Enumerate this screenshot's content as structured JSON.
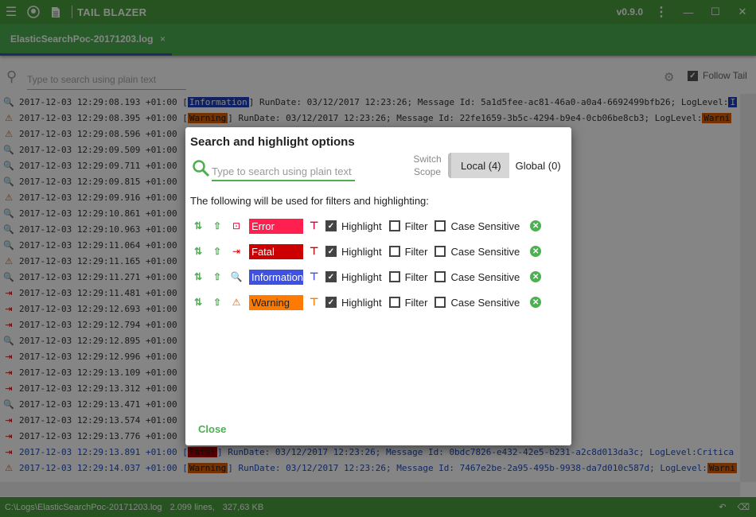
{
  "titlebar": {
    "title": "TAIL BLAZER",
    "version": "v0.9.0"
  },
  "tab": {
    "label": "ElasticSearchPoc-20171203.log",
    "close": "×"
  },
  "search": {
    "placeholder": "Type to search using plain text"
  },
  "follow_tail": {
    "label": "Follow Tail",
    "checked": true
  },
  "log_lines": [
    {
      "icon": "🔍",
      "ic": "#1f4fc0",
      "pre": "2017-12-03 12:29:08.193 +01:00 [",
      "level": "Information",
      "lvbg": "#1e3fbf",
      "lvfg": "#fff",
      "post": "] RunDate: 03/12/2017 12:23:26; Message Id: 5a1d5fee-ac81-46a0-a0a4-6692499bfb26; LogLevel: ",
      "end": "I",
      "endbg": "#1e3fbf",
      "endfg": "#fff",
      "blue": false
    },
    {
      "icon": "⚠",
      "ic": "#e06000",
      "pre": "2017-12-03 12:29:08.395 +01:00 [",
      "level": "Warning",
      "lvbg": "#e06000",
      "lvfg": "#222",
      "post": "] RunDate: 03/12/2017 12:23:26; Message Id: 22fe1659-3b5c-4294-b9e4-0cb06be8cb3; LogLevel: ",
      "end": "Warni",
      "endbg": "#e06000",
      "endfg": "#222",
      "blue": false
    },
    {
      "icon": "⚠",
      "ic": "#e06000",
      "pre": "2017-12-03 12:29:08.596 +01:00",
      "level": "",
      "lvbg": "",
      "lvfg": "",
      "post": "",
      "end": "",
      "endbg": "",
      "endfg": "",
      "blue": false
    },
    {
      "icon": "🔍",
      "ic": "#1f4fc0",
      "pre": "2017-12-03 12:29:09.509 +01:00",
      "level": "",
      "lvbg": "",
      "lvfg": "",
      "post": "",
      "end": "",
      "endbg": "",
      "endfg": "",
      "blue": false
    },
    {
      "icon": "🔍",
      "ic": "#1f4fc0",
      "pre": "2017-12-03 12:29:09.711 +01:00",
      "level": "",
      "lvbg": "",
      "lvfg": "",
      "post": "",
      "end": "",
      "endbg": "",
      "endfg": "",
      "blue": false
    },
    {
      "icon": "🔍",
      "ic": "#1f4fc0",
      "pre": "2017-12-03 12:29:09.815 +01:00",
      "level": "",
      "lvbg": "",
      "lvfg": "",
      "post": "",
      "end": "",
      "endbg": "",
      "endfg": "",
      "blue": false
    },
    {
      "icon": "⚠",
      "ic": "#e06000",
      "pre": "2017-12-03 12:29:09.916 +01:00",
      "level": "",
      "lvbg": "",
      "lvfg": "",
      "post": "",
      "end": "",
      "endbg": "",
      "endfg": "",
      "blue": false
    },
    {
      "icon": "🔍",
      "ic": "#1f4fc0",
      "pre": "2017-12-03 12:29:10.861 +01:00",
      "level": "",
      "lvbg": "",
      "lvfg": "",
      "post": "",
      "end": "",
      "endbg": "",
      "endfg": "",
      "blue": false
    },
    {
      "icon": "🔍",
      "ic": "#1f4fc0",
      "pre": "2017-12-03 12:29:10.963 +01:00",
      "level": "",
      "lvbg": "",
      "lvfg": "",
      "post": "",
      "end": "",
      "endbg": "",
      "endfg": "",
      "blue": false
    },
    {
      "icon": "🔍",
      "ic": "#1f4fc0",
      "pre": "2017-12-03 12:29:11.064 +01:00",
      "level": "",
      "lvbg": "",
      "lvfg": "",
      "post": "",
      "end": "",
      "endbg": "",
      "endfg": "",
      "blue": false
    },
    {
      "icon": "⚠",
      "ic": "#e06000",
      "pre": "2017-12-03 12:29:11.165 +01:00",
      "level": "",
      "lvbg": "",
      "lvfg": "",
      "post": "",
      "end": "",
      "endbg": "",
      "endfg": "",
      "blue": false
    },
    {
      "icon": "🔍",
      "ic": "#1f4fc0",
      "pre": "2017-12-03 12:29:11.271 +01:00",
      "level": "",
      "lvbg": "",
      "lvfg": "",
      "post": "",
      "end": "",
      "endbg": "",
      "endfg": "",
      "blue": false
    },
    {
      "icon": "⇥",
      "ic": "#c00",
      "pre": "2017-12-03 12:29:11.481 +01:00",
      "level": "",
      "lvbg": "",
      "lvfg": "",
      "post": "",
      "end": "",
      "endbg": "",
      "endfg": "",
      "blue": false
    },
    {
      "icon": "⇥",
      "ic": "#c00",
      "pre": "2017-12-03 12:29:12.693 +01:00",
      "level": "",
      "lvbg": "",
      "lvfg": "",
      "post": "",
      "end": "",
      "endbg": "",
      "endfg": "",
      "blue": false
    },
    {
      "icon": "⇥",
      "ic": "#c00",
      "pre": "2017-12-03 12:29:12.794 +01:00",
      "level": "",
      "lvbg": "",
      "lvfg": "",
      "post": "",
      "end": "",
      "endbg": "",
      "endfg": "",
      "blue": false
    },
    {
      "icon": "🔍",
      "ic": "#1f4fc0",
      "pre": "2017-12-03 12:29:12.895 +01:00",
      "level": "",
      "lvbg": "",
      "lvfg": "",
      "post": "",
      "end": "",
      "endbg": "",
      "endfg": "",
      "blue": false
    },
    {
      "icon": "⇥",
      "ic": "#c00",
      "pre": "2017-12-03 12:29:12.996 +01:00",
      "level": "",
      "lvbg": "",
      "lvfg": "",
      "post": "",
      "end": "",
      "endbg": "",
      "endfg": "",
      "blue": false
    },
    {
      "icon": "⇥",
      "ic": "#c00",
      "pre": "2017-12-03 12:29:13.109 +01:00",
      "level": "",
      "lvbg": "",
      "lvfg": "",
      "post": "",
      "end": "",
      "endbg": "",
      "endfg": "",
      "blue": false
    },
    {
      "icon": "⇥",
      "ic": "#c00",
      "pre": "2017-12-03 12:29:13.312 +01:00",
      "level": "",
      "lvbg": "",
      "lvfg": "",
      "post": "",
      "end": "",
      "endbg": "",
      "endfg": "",
      "blue": false
    },
    {
      "icon": "🔍",
      "ic": "#1f4fc0",
      "pre": "2017-12-03 12:29:13.471 +01:00",
      "level": "",
      "lvbg": "",
      "lvfg": "",
      "post": "",
      "end": "",
      "endbg": "",
      "endfg": "",
      "blue": false
    },
    {
      "icon": "⇥",
      "ic": "#c00",
      "pre": "2017-12-03 12:29:13.574 +01:00",
      "level": "",
      "lvbg": "",
      "lvfg": "",
      "post": "",
      "end": "",
      "endbg": "",
      "endfg": "",
      "blue": false
    },
    {
      "icon": "⇥",
      "ic": "#c00",
      "pre": "2017-12-03 12:29:13.776 +01:00",
      "level": "",
      "lvbg": "",
      "lvfg": "",
      "post": "",
      "end": "",
      "endbg": "",
      "endfg": "",
      "blue": false
    },
    {
      "icon": "⇥",
      "ic": "#c00",
      "pre": "2017-12-03 12:29:13.891 +01:00 [",
      "level": "Fatal",
      "lvbg": "#b00000",
      "lvfg": "#222",
      "post": "] RunDate: 03/12/2017 12:23:26; Message Id: 0bdc7826-e432-42e5-b231-a2c8d013da3c; LogLevel: ",
      "end": "Critica",
      "endbg": "",
      "endfg": "",
      "blue": true
    },
    {
      "icon": "⚠",
      "ic": "#e06000",
      "pre": "2017-12-03 12:29:14.037 +01:00 [",
      "level": "Warning",
      "lvbg": "#e06000",
      "lvfg": "#222",
      "post": "] RunDate: 03/12/2017 12:23:26; Message Id: 7467e2be-2a95-495b-9938-da7d010c587d; LogLevel: ",
      "end": "Warni",
      "endbg": "#e06000",
      "endfg": "#222",
      "blue": true
    }
  ],
  "statusbar": {
    "path": "C:\\Logs\\ElasticSearchPoc-20171203.log",
    "lines": "2.099 lines,",
    "size": "327,63 KB"
  },
  "dialog": {
    "title": "Search and highlight options",
    "search_placeholder": "Type to search using plain text",
    "scope_label": "Switch Scope",
    "scope_local": "Local (4)",
    "scope_global": "Global (0)",
    "description": "The following will be used for filters and highlighting:",
    "rules": [
      {
        "icon": "⊡",
        "icon_name": "error-icon",
        "icon_color": "#e00030",
        "label": "Error",
        "bg": "#ff2050",
        "fg": "#fff",
        "paint_color": "#e00030",
        "highlight": true,
        "filter": false,
        "case": false
      },
      {
        "icon": "⇥",
        "icon_name": "fatal-icon",
        "icon_color": "#c00",
        "label": "Fatal",
        "bg": "#cc0000",
        "fg": "#fff",
        "paint_color": "#c00",
        "highlight": true,
        "filter": false,
        "case": false
      },
      {
        "icon": "🔍",
        "icon_name": "information-icon",
        "icon_color": "#1f4fc0",
        "label": "Information",
        "bg": "#3f51e0",
        "fg": "#fff",
        "paint_color": "#3f51e0",
        "highlight": true,
        "filter": false,
        "case": false
      },
      {
        "icon": "⚠",
        "icon_name": "warning-icon",
        "icon_color": "#e06000",
        "label": "Warning",
        "bg": "#ff7a00",
        "fg": "#222",
        "paint_color": "#ff7a00",
        "highlight": true,
        "filter": false,
        "case": false
      }
    ],
    "highlight_label": "Highlight",
    "filter_label": "Filter",
    "case_label": "Case Sensitive",
    "close_label": "Close"
  }
}
